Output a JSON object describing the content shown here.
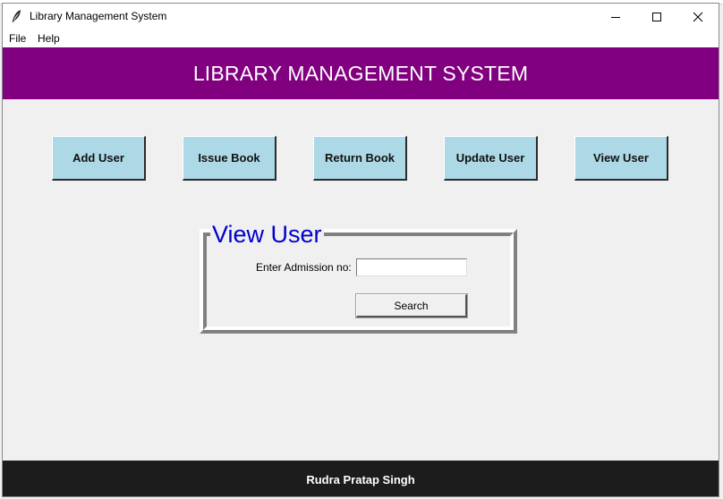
{
  "window": {
    "title": "Library Management System",
    "icon": "feather-icon"
  },
  "menubar": {
    "items": [
      {
        "label": "File"
      },
      {
        "label": "Help"
      }
    ]
  },
  "header": {
    "title": "LIBRARY MANAGEMENT SYSTEM",
    "background": "#800080"
  },
  "nav": {
    "buttons": [
      {
        "label": "Add User"
      },
      {
        "label": "Issue Book"
      },
      {
        "label": "Return Book"
      },
      {
        "label": "Update User"
      },
      {
        "label": "View User"
      }
    ],
    "button_color": "#add8e6"
  },
  "view_user": {
    "frame_title": "View User",
    "admission_label": "Enter Admission no:",
    "admission_value": "",
    "search_label": "Search",
    "title_color": "#0000cd"
  },
  "footer": {
    "text": "Rudra Pratap Singh",
    "background": "#1c1c1c"
  }
}
